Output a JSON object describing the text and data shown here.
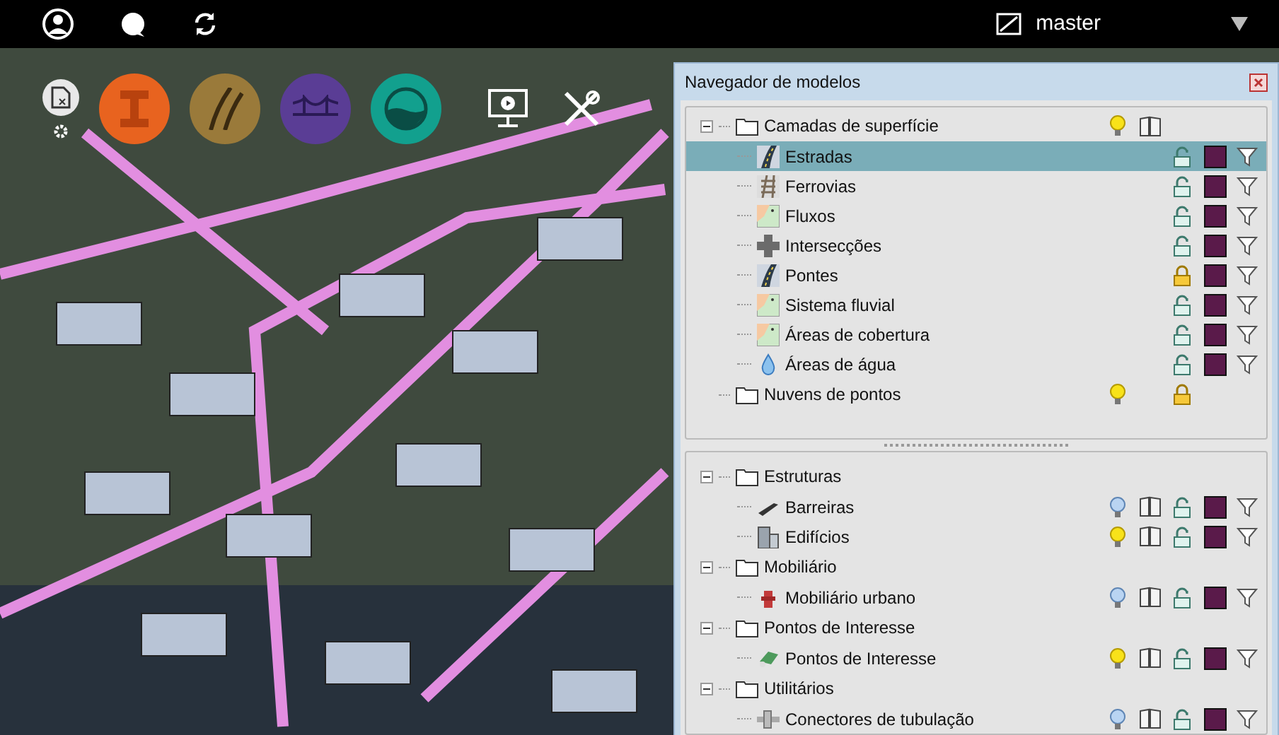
{
  "top_bar": {
    "branch": "master"
  },
  "panel": {
    "title": "Navegador de modelos",
    "upper_tree": [
      {
        "label": "Camadas de superfície",
        "expanded": true,
        "lit": true,
        "book": true,
        "children": [
          {
            "label": "Estradas",
            "kind": "road",
            "selected": true,
            "locked": false
          },
          {
            "label": "Ferrovias",
            "kind": "rail",
            "selected": false,
            "locked": false
          },
          {
            "label": "Fluxos",
            "kind": "map",
            "selected": false,
            "locked": false
          },
          {
            "label": "Intersecções",
            "kind": "junction",
            "selected": false,
            "locked": false
          },
          {
            "label": "Pontes",
            "kind": "road",
            "selected": false,
            "locked": true
          },
          {
            "label": "Sistema fluvial",
            "kind": "map",
            "selected": false,
            "locked": false
          },
          {
            "label": "Áreas de cobertura",
            "kind": "map",
            "selected": false,
            "locked": false
          },
          {
            "label": "Áreas de água",
            "kind": "drop",
            "selected": false,
            "locked": false
          }
        ]
      },
      {
        "label": "Nuvens de pontos",
        "lit": true,
        "locked": true
      }
    ],
    "lower_tree": [
      {
        "label": "Estruturas",
        "expanded": true,
        "children": [
          {
            "label": "Barreiras",
            "kind": "barrier",
            "selected": false,
            "lit": false,
            "locked": false
          },
          {
            "label": "Edifícios",
            "kind": "building",
            "selected": false,
            "lit": true,
            "locked": false
          }
        ]
      },
      {
        "label": "Mobiliário",
        "expanded": true,
        "children": [
          {
            "label": "Mobiliário urbano",
            "kind": "hydrant",
            "selected": false,
            "lit": false,
            "locked": false
          }
        ]
      },
      {
        "label": "Pontos de Interesse",
        "expanded": true,
        "children": [
          {
            "label": "Pontos de Interesse",
            "kind": "poi",
            "selected": false,
            "lit": true,
            "locked": false
          }
        ]
      },
      {
        "label": "Utilitários",
        "expanded": true,
        "children": [
          {
            "label": "Conectores de tubulação",
            "kind": "pipe",
            "selected": false,
            "lit": false,
            "locked": false
          }
        ]
      }
    ]
  }
}
